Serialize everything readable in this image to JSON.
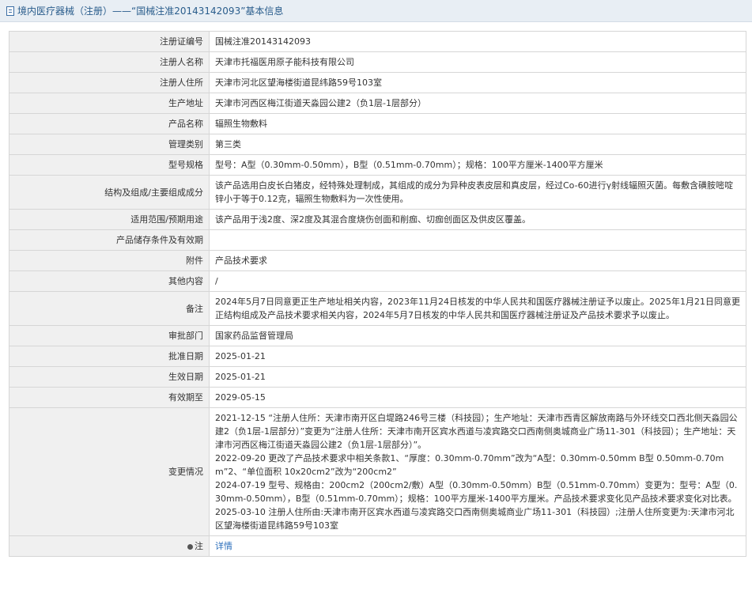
{
  "header": {
    "title": "境内医疗器械（注册）——“国械注准20143142093”基本信息"
  },
  "rows": [
    {
      "label": "注册证编号",
      "value": "国械注准20143142093"
    },
    {
      "label": "注册人名称",
      "value": "天津市托福医用原子能科技有限公司"
    },
    {
      "label": "注册人住所",
      "value": "天津市河北区望海楼街道昆纬路59号103室"
    },
    {
      "label": "生产地址",
      "value": "天津市河西区梅江街道天淼园公建2（负1层-1层部分）"
    },
    {
      "label": "产品名称",
      "value": "辐照生物敷料"
    },
    {
      "label": "管理类别",
      "value": "第三类"
    },
    {
      "label": "型号规格",
      "value": "型号：A型（0.30mm-0.50mm），B型（0.51mm-0.70mm）；规格：100平方厘米-1400平方厘米"
    },
    {
      "label": "结构及组成/主要组成成分",
      "value": "该产品选用白皮长白猪皮，经特殊处理制成，其组成的成分为异种皮表皮层和真皮层，经过Co-60进行γ射线辐照灭菌。每敷含磺胺嘧啶锌小于等于0.12克，辐照生物敷料为一次性使用。"
    },
    {
      "label": "适用范围/预期用途",
      "value": "该产品用于浅2度、深2度及其混合度烧伤创面和削痂、切痂创面区及供皮区覆盖。"
    },
    {
      "label": "产品储存条件及有效期",
      "value": ""
    },
    {
      "label": "附件",
      "value": "产品技术要求"
    },
    {
      "label": "其他内容",
      "value": "/"
    },
    {
      "label": "备注",
      "value": "2024年5月7日同意更正生产地址相关内容，2023年11月24日核发的中华人民共和国医疗器械注册证予以废止。2025年1月21日同意更正结构组成及产品技术要求相关内容，2024年5月7日核发的中华人民共和国医疗器械注册证及产品技术要求予以废止。"
    },
    {
      "label": "审批部门",
      "value": "国家药品监督管理局"
    },
    {
      "label": "批准日期",
      "value": "2025-01-21"
    },
    {
      "label": "生效日期",
      "value": "2025-01-21"
    },
    {
      "label": "有效期至",
      "value": "2029-05-15"
    }
  ],
  "changes": {
    "label": "变更情况",
    "entries": [
      "2021-12-15 “注册人住所：天津市南开区白堤路246号三楼（科技园）；生产地址：天津市西青区解放南路与外环线交口西北侧天淼园公建2（负1层-1层部分）”变更为“注册人住所：天津市南开区宾水西道与凌宾路交口西南侧奥城商业广场11-301（科技园）；生产地址：天津市河西区梅江街道天淼园公建2（负1层-1层部分）”。",
      "2022-09-20 更改了产品技术要求中相关条款1、“厚度：0.30mm-0.70mm”改为“A型：0.30mm-0.50mm B型 0.50mm-0.70mm”2、“单位面积 10x20cm2”改为“200cm2”",
      "2024-07-19 型号、规格由：200cm2（200cm2/敷）A型（0.30mm-0.50mm）B型（0.51mm-0.70mm）变更为：型号：A型（0.30mm-0.50mm），B型（0.51mm-0.70mm）；规格：100平方厘米-1400平方厘米。产品技术要求变化见产品技术要求变化对比表。",
      "2025-03-10 注册人住所由:天津市南开区宾水西道与凌宾路交口西南侧奥城商业广场11-301（科技园）;注册人住所变更为:天津市河北区望海楼街道昆纬路59号103室"
    ]
  },
  "note": {
    "label": "注",
    "icon": "bulb-icon",
    "link_text": "详情",
    "link_color": "#2a6ebb"
  },
  "colors": {
    "header_bg": "#e8eef4",
    "header_text": "#2a5d8c",
    "label_bg": "#f0f0f0",
    "border": "#d6d6d6"
  }
}
